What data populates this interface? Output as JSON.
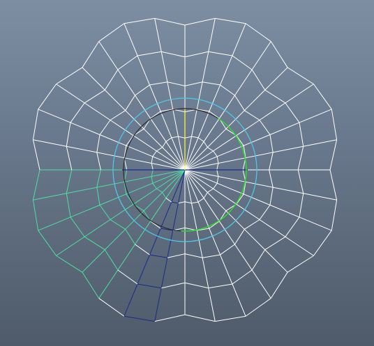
{
  "viewport": {
    "background_top": "#7d8ea3",
    "background_bottom": "#4f5b69"
  },
  "mesh": {
    "spoke_count": 32,
    "ring_count": 5,
    "lobe_count": 8,
    "colors": {
      "default": "#ffffff",
      "selected_light": "#4fe0a0",
      "selected_dark": "#1a2a8c",
      "axis_x": "#1a2a8c",
      "axis_y": "#ffff40"
    }
  },
  "manipulators": {
    "outer_circle_color": "#4fc8e8",
    "inner_circle_color": "#2b2b2b",
    "rotate_arc_color": "#30e030"
  }
}
